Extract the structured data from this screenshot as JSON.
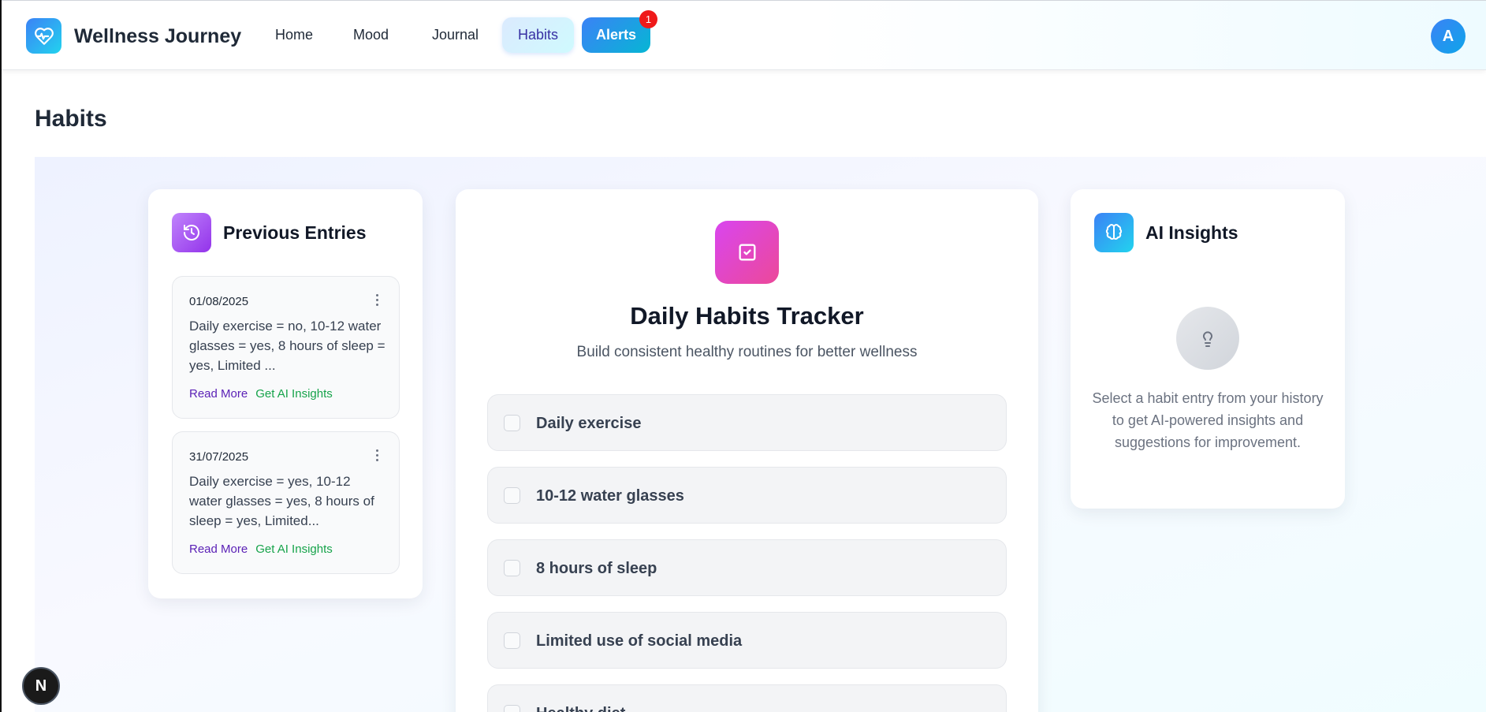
{
  "brand": {
    "name": "Wellness Journey",
    "icon": "heart-pulse-icon"
  },
  "nav": {
    "home": "Home",
    "mood": "Mood",
    "journal": "Journal",
    "habits": "Habits",
    "alerts": "Alerts",
    "alerts_count": "1",
    "active": "Habits"
  },
  "user": {
    "avatar_initial": "A"
  },
  "page": {
    "title": "Habits"
  },
  "history": {
    "title": "Previous Entries",
    "icon": "history-icon",
    "entries": [
      {
        "date": "01/08/2025",
        "text": "Daily exercise = no, 10-12 water glasses = yes, 8 hours of sleep = yes, Limited ...",
        "read_more": "Read More",
        "insights": "Get AI Insights"
      },
      {
        "date": "31/07/2025",
        "text": "Daily exercise = yes, 10-12 water glasses = yes, 8 hours of sleep = yes, Limited...",
        "read_more": "Read More",
        "insights": "Get AI Insights"
      }
    ]
  },
  "tracker": {
    "title": "Daily Habits Tracker",
    "subtitle": "Build consistent healthy routines for better wellness",
    "icon": "check-square-icon",
    "habits": [
      {
        "label": "Daily exercise",
        "checked": false
      },
      {
        "label": "10-12 water glasses",
        "checked": false
      },
      {
        "label": "8 hours of sleep",
        "checked": false
      },
      {
        "label": "Limited use of social media",
        "checked": false
      },
      {
        "label": "Healthy diet",
        "checked": false
      }
    ]
  },
  "insights": {
    "title": "AI Insights",
    "icon": "brain-icon",
    "empty_icon": "lightbulb-icon",
    "empty_text": "Select a habit entry from your history to get AI-powered insights and suggestions for improvement."
  },
  "dev_badge": {
    "letter": "N"
  },
  "colors": {
    "accent_blue": "#3b82f6",
    "accent_cyan": "#06b6d4",
    "purple": "#9333ea",
    "pink": "#ec4899",
    "badge_red": "#ef1a1a",
    "link_purple": "#5b21b6",
    "link_green": "#16a34a"
  }
}
